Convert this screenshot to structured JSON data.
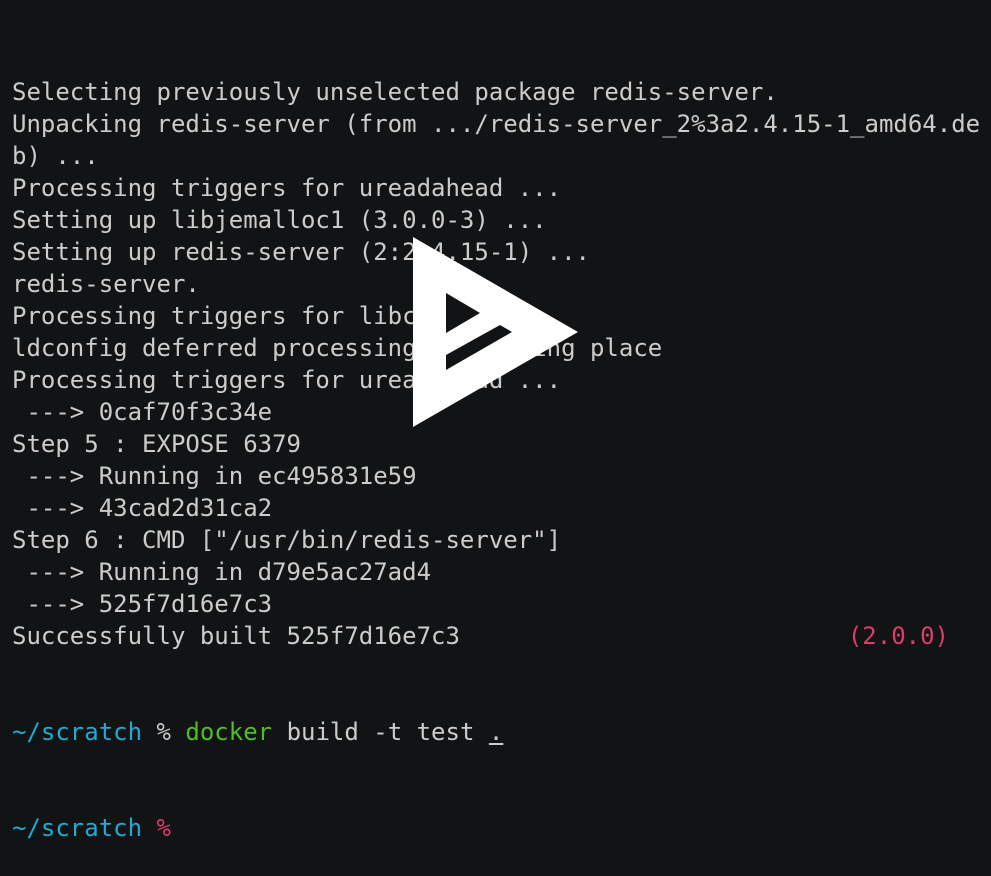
{
  "terminal": {
    "lines": [
      "Selecting previously unselected package redis-server.",
      "Unpacking redis-server (from .../redis-server_2%3a2.4.15-1_amd64.de",
      "b) ...",
      "Processing triggers for ureadahead ...",
      "Setting up libjemalloc1 (3.0.0-3) ...",
      "Setting up redis-server (2:2.4.15-1) ...",
      "redis-server.",
      "Processing triggers for libc-bin ...",
      "ldconfig deferred processing now taking place",
      "Processing triggers for ureadahead ...",
      " ---> 0caf70f3c34e",
      "Step 5 : EXPOSE 6379",
      " ---> Running in ec495831e59",
      " ---> 43cad2d31ca2",
      "Step 6 : CMD [\"/usr/bin/redis-server\"]",
      " ---> Running in d79e5ac27ad4",
      " ---> 525f7d16e7c3",
      "Successfully built 525f7d16e7c3"
    ],
    "prompt1": {
      "path": "~/scratch",
      "symbol": "%",
      "command": "docker",
      "args": "build -t test",
      "cursor_char": "."
    },
    "prompt2": {
      "path": "~/scratch",
      "symbol": "%"
    },
    "version": "(2.0.0)"
  },
  "overlay": {
    "icon": "asciinema-play-icon"
  },
  "colors": {
    "background": "#121314",
    "text": "#cccccc",
    "path": "#1fa9d3",
    "command": "#4ebf22",
    "prompt_error": "#dd3c69"
  }
}
